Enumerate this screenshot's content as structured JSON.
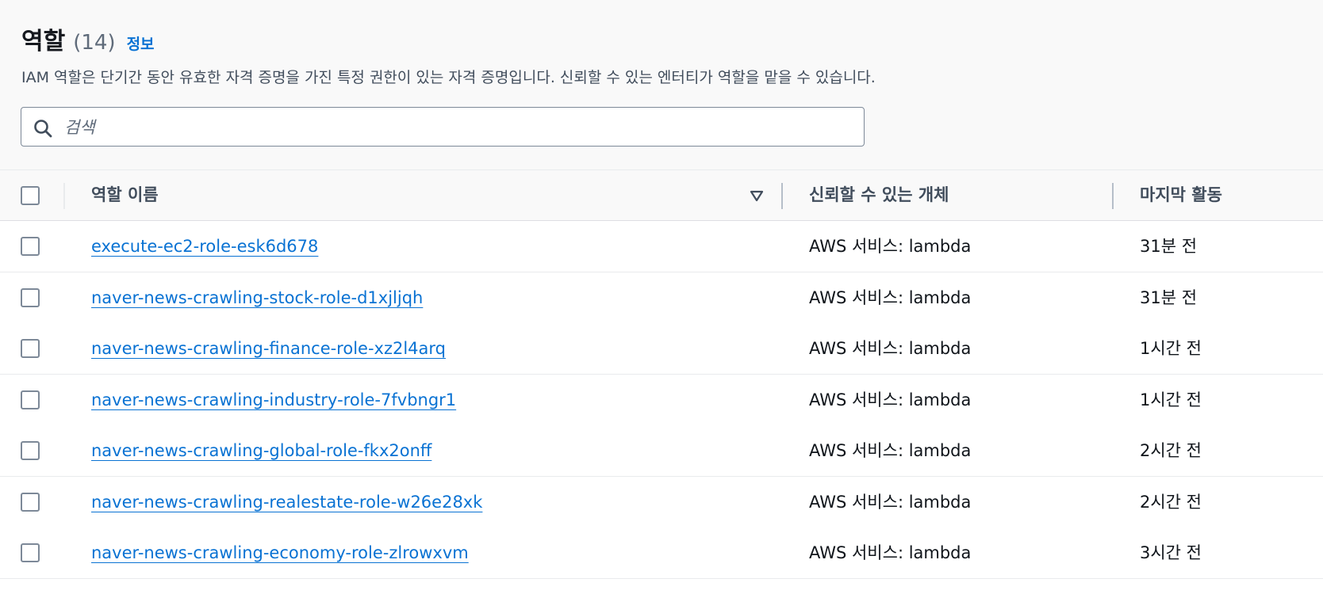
{
  "header": {
    "title": "역할",
    "count": "(14)",
    "info_link": "정보",
    "description": "IAM 역할은 단기간 동안 유효한 자격 증명을 가진 특정 권한이 있는 자격 증명입니다. 신뢰할 수 있는 엔터티가 역할을 맡을 수 있습니다."
  },
  "search": {
    "placeholder": "검색",
    "value": ""
  },
  "table": {
    "columns": {
      "role_name": "역할 이름",
      "trusted_entity": "신뢰할 수 있는 개체",
      "last_activity": "마지막 활동"
    },
    "rows": [
      {
        "name": "execute-ec2-role-esk6d678",
        "entity": "AWS 서비스: lambda",
        "activity": "31분 전"
      },
      {
        "name": "naver-news-crawling-stock-role-d1xjljqh",
        "entity": "AWS 서비스: lambda",
        "activity": "31분 전"
      },
      {
        "name": "naver-news-crawling-finance-role-xz2l4arq",
        "entity": "AWS 서비스: lambda",
        "activity": "1시간 전"
      },
      {
        "name": "naver-news-crawling-industry-role-7fvbngr1",
        "entity": "AWS 서비스: lambda",
        "activity": "1시간 전"
      },
      {
        "name": "naver-news-crawling-global-role-fkx2onff",
        "entity": "AWS 서비스: lambda",
        "activity": "2시간 전"
      },
      {
        "name": "naver-news-crawling-realestate-role-w26e28xk",
        "entity": "AWS 서비스: lambda",
        "activity": "2시간 전"
      },
      {
        "name": "naver-news-crawling-economy-role-zlrowxvm",
        "entity": "AWS 서비스: lambda",
        "activity": "3시간 전"
      }
    ]
  },
  "icons": {
    "search": "search-icon",
    "sort": "sort-descending-icon",
    "checkbox": "checkbox-icon"
  },
  "colors": {
    "link": "#0972d3",
    "text": "#0f141a",
    "muted": "#5f6b7a"
  }
}
